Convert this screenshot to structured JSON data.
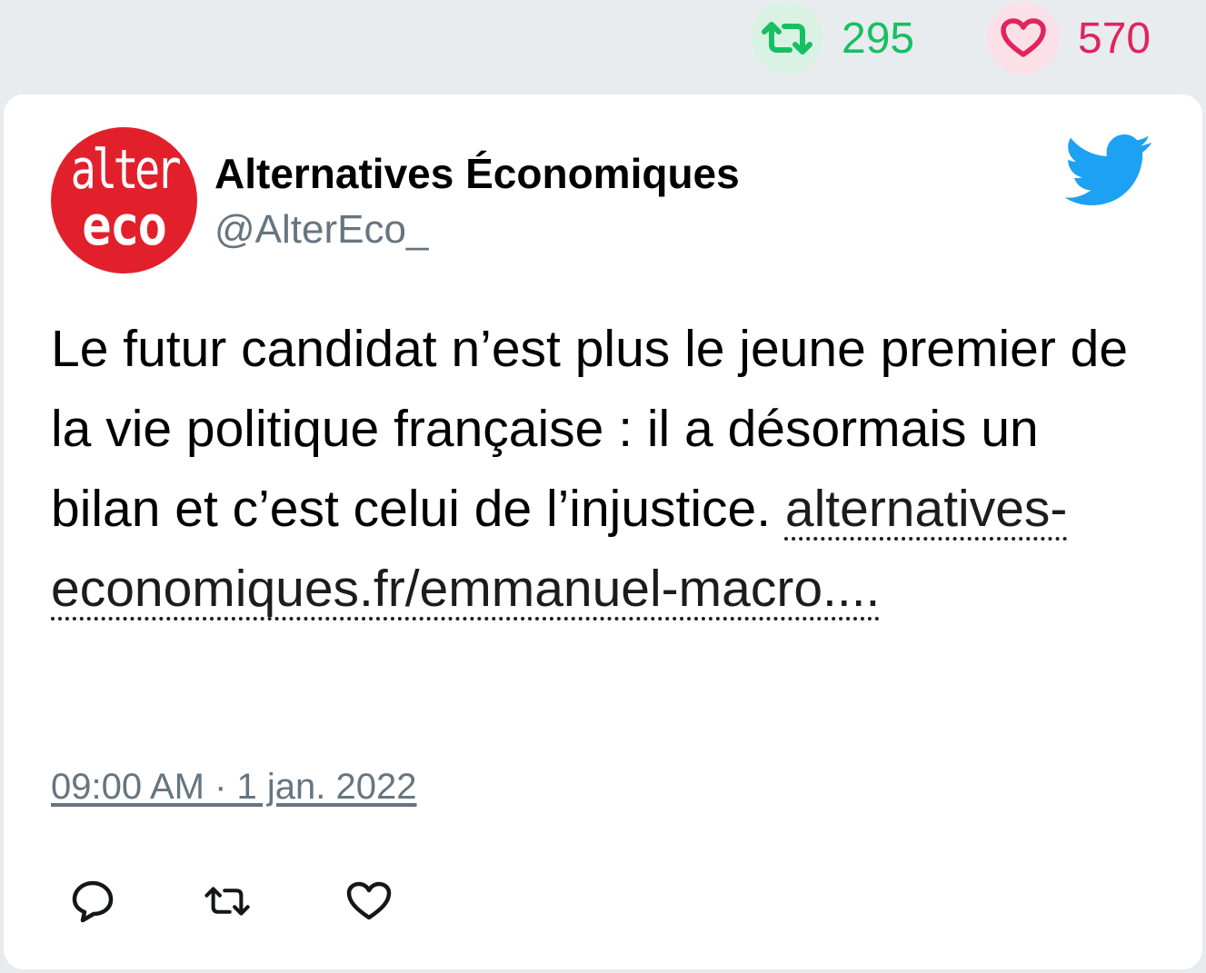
{
  "stats": {
    "retweets": "295",
    "likes": "570"
  },
  "tweet": {
    "author": {
      "display_name": "Alternatives Économiques",
      "handle": "@AlterEco_",
      "avatar_line1": "alter",
      "avatar_line2": "eco"
    },
    "text": "Le futur candidat n’est plus le jeune premier de la vie politique française : il a désormais un bilan et c’est celui de l’injustice.",
    "link_text": "alternatives-economiques.fr/emmanuel-macro....",
    "timestamp": "09:00 AM · 1 jan. 2022"
  },
  "icons": {
    "retweet": "retweet-icon",
    "like": "heart-icon",
    "reply": "reply-icon",
    "brand": "twitter-bird-icon"
  },
  "colors": {
    "retweet_green": "#17bf63",
    "like_red": "#e0245e",
    "twitter_blue": "#1da1f2",
    "avatar_red": "#e2202b",
    "muted_gray": "#66757f"
  }
}
